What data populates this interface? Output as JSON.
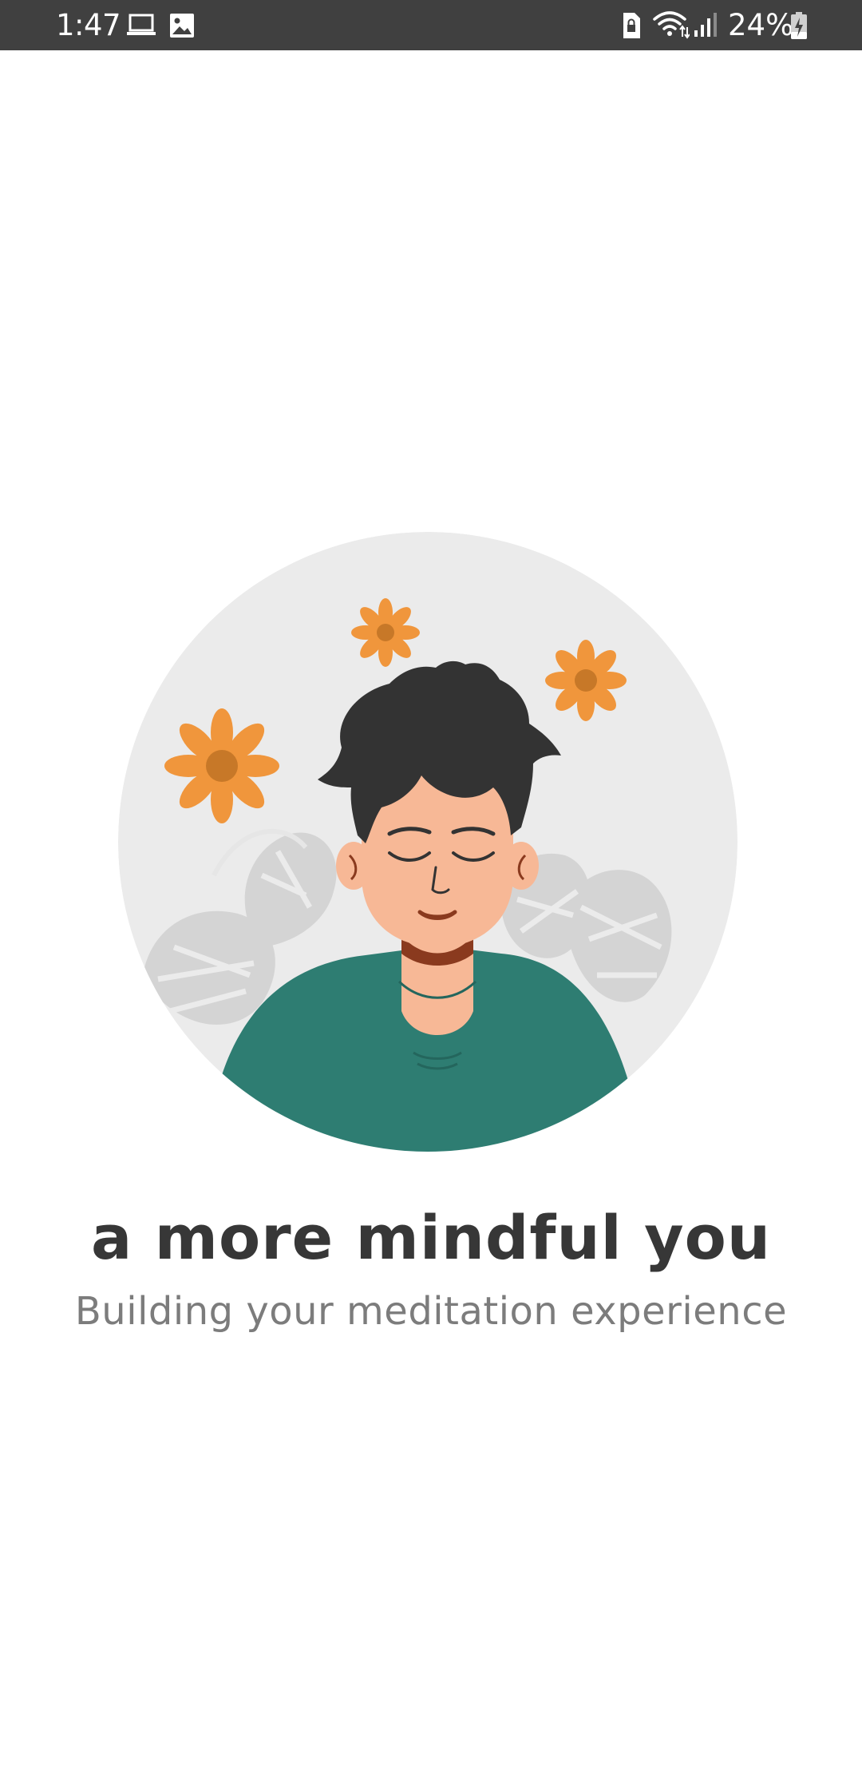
{
  "status_bar": {
    "time": "1:47",
    "battery": "24%",
    "icons": [
      "laptop-icon",
      "image-icon",
      "sim-lock-icon",
      "wifi-icon",
      "signal-icon",
      "battery-charging-icon"
    ]
  },
  "colors": {
    "status_bar_bg": "#404040",
    "circle_bg": "#ebebeb",
    "shirt": "#2e7d72",
    "skin": "#f7b896",
    "hair": "#333333",
    "flower": "#f0963c",
    "flower_center": "#c77828",
    "leaves": "#d4d4d4",
    "headline": "#373737",
    "subtitle": "#7c7c7c"
  },
  "splash": {
    "illustration": "meditating-person-illustration",
    "headline": "a more mindful you",
    "subtitle": "Building your meditation experience"
  }
}
